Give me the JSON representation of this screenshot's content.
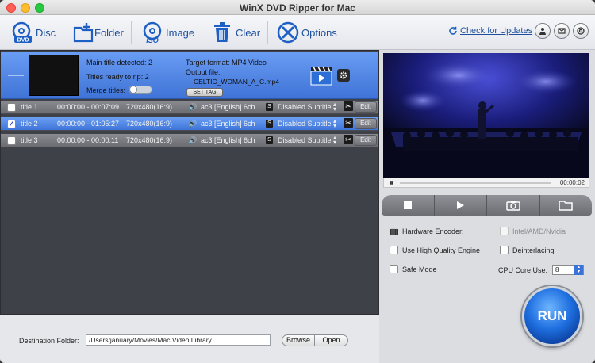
{
  "window": {
    "title": "WinX DVD Ripper for Mac"
  },
  "toolbar": {
    "disc": "Disc",
    "folder": "Folder",
    "image": "Image",
    "clear": "Clear",
    "options": "Options",
    "check_updates": "Check for Updates"
  },
  "summary": {
    "main_title": "Main title detected: 2",
    "titles_ready": "Titles ready to rip: 2",
    "merge_titles": "Merge titles:",
    "target_format": "Target format: MP4 Video",
    "output_file_label": "Output file:",
    "output_file": "CELTIC_WOMAN_A_C.mp4",
    "set_tag": "SET TAG"
  },
  "titles": [
    {
      "name": "title 1",
      "time": "00:00:00 - 00:07:09",
      "res": "720x480(16:9)",
      "audio": "ac3 [English] 6ch",
      "subtitle": "Disabled Subtitle",
      "edit": "Edit",
      "checked": false,
      "selected": false
    },
    {
      "name": "title 2",
      "time": "00:00:00 - 01:05:27",
      "res": "720x480(16:9)",
      "audio": "ac3 [English] 6ch",
      "subtitle": "Disabled Subtitle",
      "edit": "Edit",
      "checked": true,
      "selected": true
    },
    {
      "name": "title 3",
      "time": "00:00:00 - 00:00:11",
      "res": "720x480(16:9)",
      "audio": "ac3 [English] 6ch",
      "subtitle": "Disabled Subtitle",
      "edit": "Edit",
      "checked": false,
      "selected": false
    }
  ],
  "bottom": {
    "dest_label": "Destination Folder:",
    "dest_path": "/Users/january/Movies/Mac Video Library",
    "browse": "Browse",
    "open": "Open"
  },
  "preview": {
    "time": "00:00:02"
  },
  "options": {
    "hw_encoder": "Hardware Encoder:",
    "hw_value": "Intel/AMD/Nvidia",
    "high_quality": "Use High Quality Engine",
    "deinterlacing": "Deinterlacing",
    "safe_mode": "Safe Mode",
    "cpu_core": "CPU Core Use:",
    "cpu_value": "8"
  },
  "run": {
    "label": "RUN"
  },
  "colors": {
    "accent": "#3f73d6",
    "brand_blue": "#1d4f9c"
  }
}
